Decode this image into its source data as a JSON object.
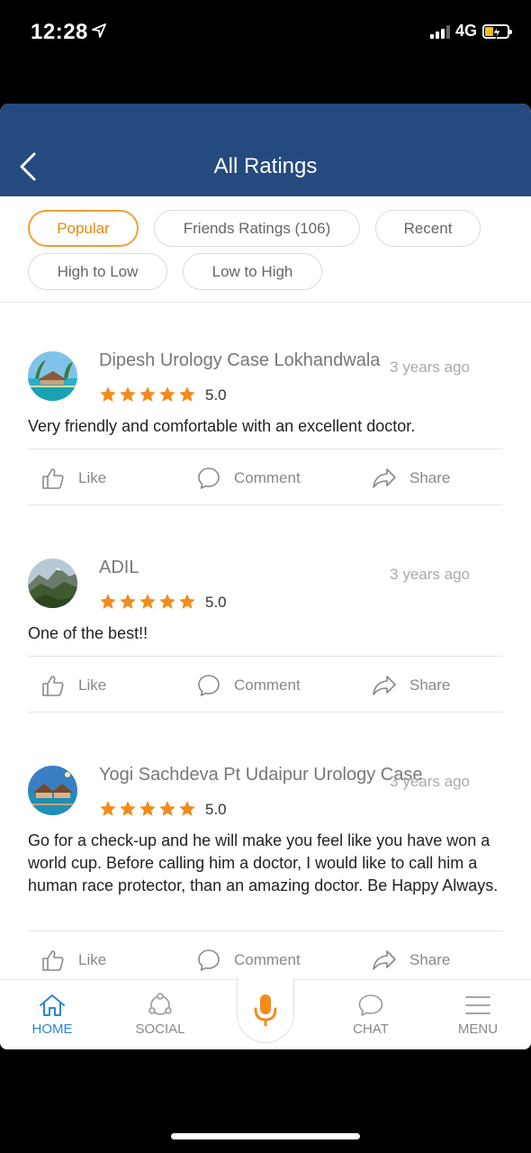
{
  "status": {
    "time": "12:28",
    "network": "4G"
  },
  "header": {
    "title": "All Ratings"
  },
  "filters": [
    {
      "label": "Popular",
      "active": true
    },
    {
      "label": "Friends Ratings (106)",
      "active": false
    },
    {
      "label": "Recent",
      "active": false
    },
    {
      "label": "High to Low",
      "active": false
    },
    {
      "label": "Low to High",
      "active": false
    }
  ],
  "reviews": [
    {
      "name": "Dipesh Urology Case Lokhandwala",
      "time": "3 years ago",
      "rating": "5.0",
      "stars": 5,
      "text": "Very friendly and comfortable with an excellent doctor."
    },
    {
      "name": "ADIL",
      "time": "3 years ago",
      "rating": "5.0",
      "stars": 5,
      "text": "One of the best!!"
    },
    {
      "name": "Yogi Sachdeva Pt Udaipur Urology Case",
      "time": "3 years ago",
      "rating": "5.0",
      "stars": 5,
      "text": "Go for a check-up and he will make you feel like you have won a world cup. Before calling him a doctor, I would like to call him a human race protector, than an amazing doctor. Be Happy Always."
    }
  ],
  "actions": {
    "like": "Like",
    "comment": "Comment",
    "share": "Share"
  },
  "tabs": {
    "home": "HOME",
    "social": "SOCIAL",
    "chat": "CHAT",
    "menu": "MENU"
  },
  "colors": {
    "header": "#254a7f",
    "accent": "#f28b1c",
    "active_tab": "#2d86d8",
    "star": "#f28b1c"
  }
}
